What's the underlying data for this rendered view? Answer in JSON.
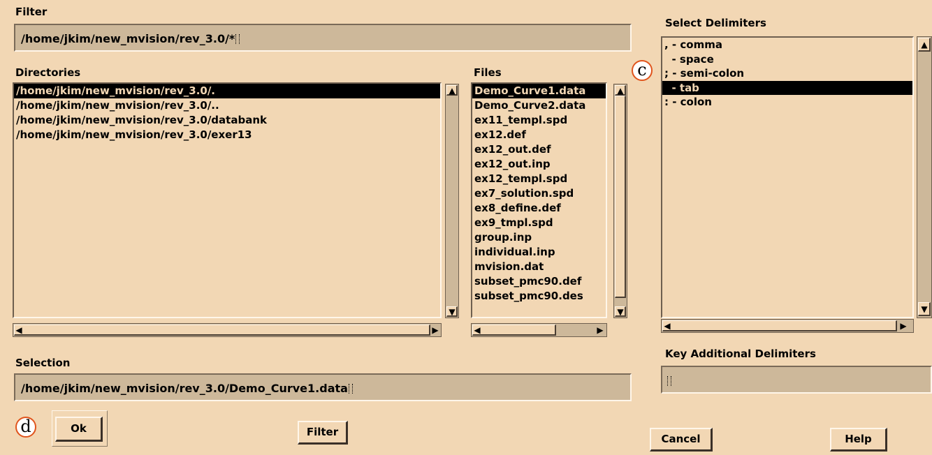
{
  "filter": {
    "label": "Filter",
    "value": "/home/jkim/new_mvision/rev_3.0/*"
  },
  "directories": {
    "label": "Directories",
    "items": [
      "/home/jkim/new_mvision/rev_3.0/.",
      "/home/jkim/new_mvision/rev_3.0/..",
      "/home/jkim/new_mvision/rev_3.0/databank",
      "/home/jkim/new_mvision/rev_3.0/exer13"
    ],
    "selected_index": 0
  },
  "files": {
    "label": "Files",
    "items": [
      "Demo_Curve1.data",
      "Demo_Curve2.data",
      "ex11_templ.spd",
      "ex12.def",
      "ex12_out.def",
      "ex12_out.inp",
      "ex12_templ.spd",
      "ex7_solution.spd",
      "ex8_define.def",
      "ex9_tmpl.spd",
      "group.inp",
      "individual.inp",
      "mvision.dat",
      "subset_pmc90.def",
      "subset_pmc90.des"
    ],
    "selected_index": 0
  },
  "delimiters": {
    "label": "Select Delimiters",
    "items": [
      ", - comma",
      "  - space",
      "; - semi-colon",
      "  - tab",
      ": - colon"
    ],
    "selected_index": 3
  },
  "additional": {
    "label": "Key Additional Delimiters",
    "value": ""
  },
  "selection": {
    "label": "Selection",
    "value": "/home/jkim/new_mvision/rev_3.0/Demo_Curve1.data"
  },
  "buttons": {
    "ok": "Ok",
    "filter": "Filter",
    "cancel": "Cancel",
    "help": "Help"
  },
  "callouts": {
    "c": "c",
    "d": "d"
  },
  "icons": {
    "scroll_up": "arrow-up-icon",
    "scroll_down": "arrow-down-icon",
    "scroll_left": "arrow-left-icon",
    "scroll_right": "arrow-right-icon"
  }
}
